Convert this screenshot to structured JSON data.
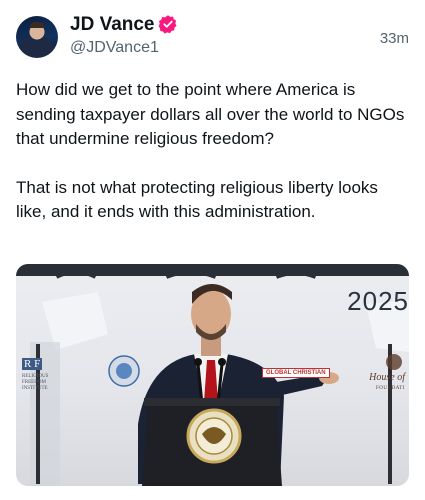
{
  "author": {
    "name": "JD Vance",
    "handle": "@JDVance1",
    "avatar_icon": "profile-photo",
    "verified_icon": "verified-badge-icon",
    "verified_color": "#f91880"
  },
  "timestamp": "33m",
  "tweet": {
    "paragraphs": [
      "How did we get to the point where America is sending taxpayer dollars all over the world to NGOs that undermine religious freedom?",
      "That is not what protecting religious liberty looks like, and it ends with this administration."
    ]
  },
  "media": {
    "backdrop_year": "2025",
    "rf_logo_mark": "R F",
    "rf_logo_text": "Religious Freedom Institute",
    "banner_text": "GLOBAL CHRISTIAN",
    "house_text": "House of",
    "house_sub": "FOUNDATI"
  }
}
